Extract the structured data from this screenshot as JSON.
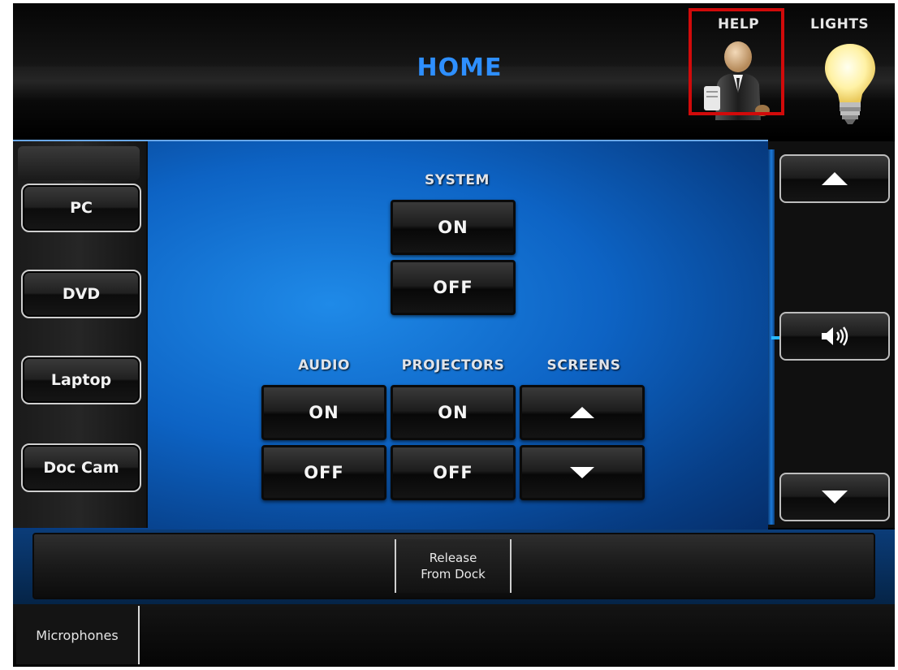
{
  "header": {
    "title": "HOME",
    "help_label": "HELP",
    "lights_label": "LIGHTS",
    "help_icon": "help-attendant-icon",
    "lights_icon": "light-bulb-icon",
    "title_color": "#2e8fff",
    "highlight_color": "#d10a0a"
  },
  "sources": [
    {
      "label": "PC"
    },
    {
      "label": "DVD"
    },
    {
      "label": "Laptop"
    },
    {
      "label": "Doc Cam"
    }
  ],
  "system": {
    "label": "SYSTEM",
    "on_label": "ON",
    "off_label": "OFF"
  },
  "audio": {
    "label": "AUDIO",
    "on_label": "ON",
    "off_label": "OFF"
  },
  "projectors": {
    "label": "PROJECTORS",
    "on_label": "ON",
    "off_label": "OFF"
  },
  "screens": {
    "label": "SCREENS",
    "up_icon": "triangle-up-icon",
    "down_icon": "triangle-down-icon"
  },
  "volume": {
    "up_icon": "triangle-up-icon",
    "mute_icon": "speaker-icon",
    "down_icon": "triangle-down-icon"
  },
  "dock": {
    "release_line1": "Release",
    "release_line2": "From Dock"
  },
  "footer": {
    "microphones_label": "Microphones"
  }
}
